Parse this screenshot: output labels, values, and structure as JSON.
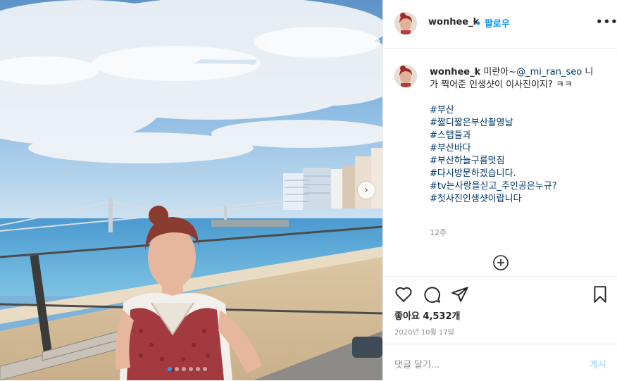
{
  "header": {
    "username": "wonhee_k",
    "separator": "•",
    "follow_label": "팔로우",
    "more_label": "•••"
  },
  "caption": {
    "username": "wonhee_k",
    "text_prefix": " 미란아~",
    "mention": "@_mi_ran_seo",
    "text_body": " 니가 찍어준 인생샷이 이사진이지? ㅋㅋ",
    "hashtags": [
      "#부산",
      "#짧디짧은부산촬영날",
      "#스탭들과",
      "#부산바다",
      "#부산하늘구름멋짐",
      "#다시방문하겠습니다.",
      "#tv는사랑을싣고_주인공은누규?",
      "#첫사진인생샷이랍니다"
    ],
    "age": "12주"
  },
  "likes": {
    "label": "좋아요 4,532개"
  },
  "post_date": "2020년 10월 17일",
  "comment_bar": {
    "placeholder": "댓글 달기...",
    "post_label": "게시"
  },
  "carousel": {
    "next_glyph": "›",
    "dot_count": 6,
    "active_index": 0
  },
  "colors": {
    "link": "#0095f6",
    "hashtag": "#00376b",
    "muted": "#8e8e8e",
    "disabled_post": "#b2dffc"
  }
}
